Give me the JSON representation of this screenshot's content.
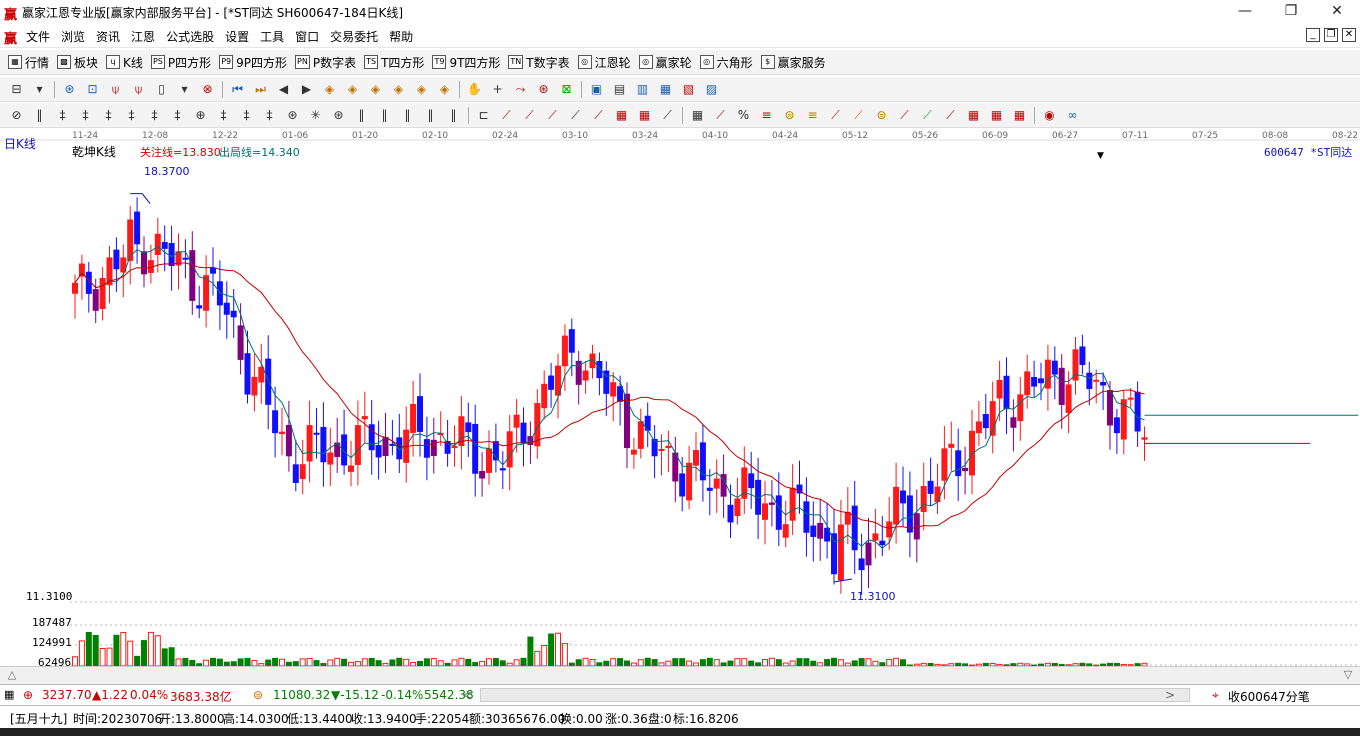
{
  "window": {
    "title": "赢家江恩专业版[赢家内部服务平台] - [*ST同达  SH600647-184日K线]",
    "app_icon": "赢"
  },
  "menu": [
    "文件",
    "浏览",
    "资讯",
    "江恩",
    "公式选股",
    "设置",
    "工具",
    "窗口",
    "交易委托",
    "帮助"
  ],
  "toolbar1": [
    {
      "icon": "▦",
      "label": "行情"
    },
    {
      "icon": "▩",
      "label": "板块"
    },
    {
      "icon": "ɥ",
      "label": "K线"
    },
    {
      "icon": "PS",
      "label": "P四方形"
    },
    {
      "icon": "P9",
      "label": "9P四方形"
    },
    {
      "icon": "PN",
      "label": "P数字表"
    },
    {
      "icon": "TS",
      "label": "T四方形"
    },
    {
      "icon": "T9",
      "label": "9T四方形"
    },
    {
      "icon": "TN",
      "label": "T数字表"
    },
    {
      "icon": "◎",
      "label": "江恩轮"
    },
    {
      "icon": "◎",
      "label": "赢家轮"
    },
    {
      "icon": "◎",
      "label": "六角形"
    },
    {
      "icon": "$",
      "label": "赢家服务"
    }
  ],
  "chart": {
    "period_label": "日K线",
    "indicator_name": "乾坤K线",
    "focus_line_text": "关注线=13.830",
    "exit_line_text": "出局线=14.340",
    "stock_label": "600647 *ST同达",
    "high_marker": "18.3700",
    "low_marker": "11.3100",
    "price_axis_low": "11.3100",
    "volume_ticks": [
      "187487",
      "124991",
      "62496"
    ],
    "date_ticks": [
      "11-24",
      "12-08",
      "12-22",
      "01-06",
      "01-20",
      "02-10",
      "02-24",
      "03-10",
      "03-24",
      "04-10",
      "04-24",
      "05-12",
      "05-26",
      "06-09",
      "06-27",
      "07-11",
      "07-25",
      "08-08",
      "08-22"
    ],
    "colors": {
      "up": "#ff1a1a",
      "down": "#1010ff",
      "neutral": "#800080",
      "volume_down": "#008000",
      "ma_slow": "#c00000",
      "ma_fast": "#007070",
      "focus": "#cc0000",
      "exit": "#007070"
    }
  },
  "chart_data": {
    "type": "candlestick",
    "ylim": [
      11.0,
      19.0
    ],
    "dates": [
      "11-24",
      "12-08",
      "12-22",
      "01-06",
      "01-20",
      "02-10",
      "02-24",
      "03-10",
      "03-24",
      "04-10",
      "04-24",
      "05-12",
      "05-26",
      "06-09",
      "06-27",
      "07-11"
    ],
    "close": [
      16.5,
      17.5,
      16.5,
      13.6,
      13.8,
      14.0,
      13.5,
      15.6,
      13.8,
      13.0,
      12.6,
      11.9,
      13.0,
      14.6,
      15.2,
      14.0
    ],
    "high_price": 18.37,
    "low_price": 11.31,
    "focus_line": 13.83,
    "exit_line": 14.34,
    "volume_max": 187487
  },
  "indexbar": {
    "sh_value": "3237.70",
    "sh_change": "▲1.22",
    "sh_pct": "0.04%",
    "sh_amount": "3683.38亿",
    "sz_value": "11080.32",
    "sz_change": "▼-15.12",
    "sz_pct": "-0.14%",
    "sz_amount": "5542.38",
    "ticks_label": "收600647分笔"
  },
  "status": {
    "lunar": "[五月十九]",
    "time": "时间:20230706",
    "open": "开:13.8000",
    "high": "高:14.0300",
    "low": "低:13.4400",
    "close": "收:13.9400",
    "hand": "手:22054",
    "amount": "额:30365676.00",
    "turnover": "换:0.00",
    "change": "涨:0.36",
    "pan": "盘:0",
    "mark": "标:16.8206"
  }
}
